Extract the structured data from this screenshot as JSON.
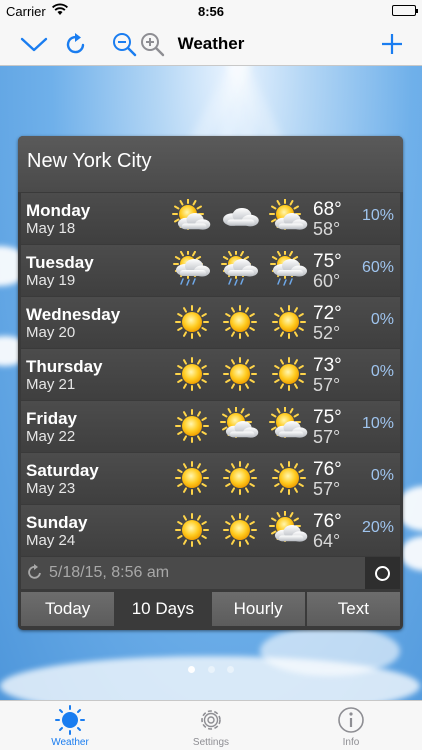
{
  "status": {
    "carrier": "Carrier",
    "time": "8:56"
  },
  "nav": {
    "title": "Weather",
    "icons": [
      "chevron-down-icon",
      "refresh-icon",
      "zoom-out-icon",
      "zoom-in-icon",
      "add-icon"
    ],
    "accent": "#1a7df0"
  },
  "panel": {
    "city": "New York City",
    "days": [
      {
        "day": "Monday",
        "date": "May 18",
        "icons": [
          "sun-cloud",
          "cloud",
          "sun-cloud"
        ],
        "hi": "68°",
        "lo": "58°",
        "pct": "10%"
      },
      {
        "day": "Tuesday",
        "date": "May 19",
        "icons": [
          "sun-rain",
          "sun-rain",
          "sun-rain"
        ],
        "hi": "75°",
        "lo": "60°",
        "pct": "60%"
      },
      {
        "day": "Wednesday",
        "date": "May 20",
        "icons": [
          "sun",
          "sun",
          "sun"
        ],
        "hi": "72°",
        "lo": "52°",
        "pct": "0%"
      },
      {
        "day": "Thursday",
        "date": "May 21",
        "icons": [
          "sun",
          "sun",
          "sun"
        ],
        "hi": "73°",
        "lo": "57°",
        "pct": "0%"
      },
      {
        "day": "Friday",
        "date": "May 22",
        "icons": [
          "sun",
          "sun-cloud",
          "sun-cloud"
        ],
        "hi": "75°",
        "lo": "57°",
        "pct": "10%"
      },
      {
        "day": "Saturday",
        "date": "May 23",
        "icons": [
          "sun",
          "sun",
          "sun"
        ],
        "hi": "76°",
        "lo": "57°",
        "pct": "0%"
      },
      {
        "day": "Sunday",
        "date": "May 24",
        "icons": [
          "sun",
          "sun",
          "sun-cloud"
        ],
        "hi": "76°",
        "lo": "64°",
        "pct": "20%"
      }
    ],
    "updated": "5/18/15, 8:56 am",
    "tabs": [
      "Today",
      "10 Days",
      "Hourly",
      "Text"
    ],
    "active_tab": "10 Days"
  },
  "page_dots": {
    "count": 3,
    "current": 1
  },
  "tabbar": {
    "items": [
      {
        "label": "Weather",
        "icon": "sun-icon",
        "active": true
      },
      {
        "label": "Settings",
        "icon": "gear-icon",
        "active": false
      },
      {
        "label": "Info",
        "icon": "info-icon",
        "active": false
      }
    ]
  }
}
